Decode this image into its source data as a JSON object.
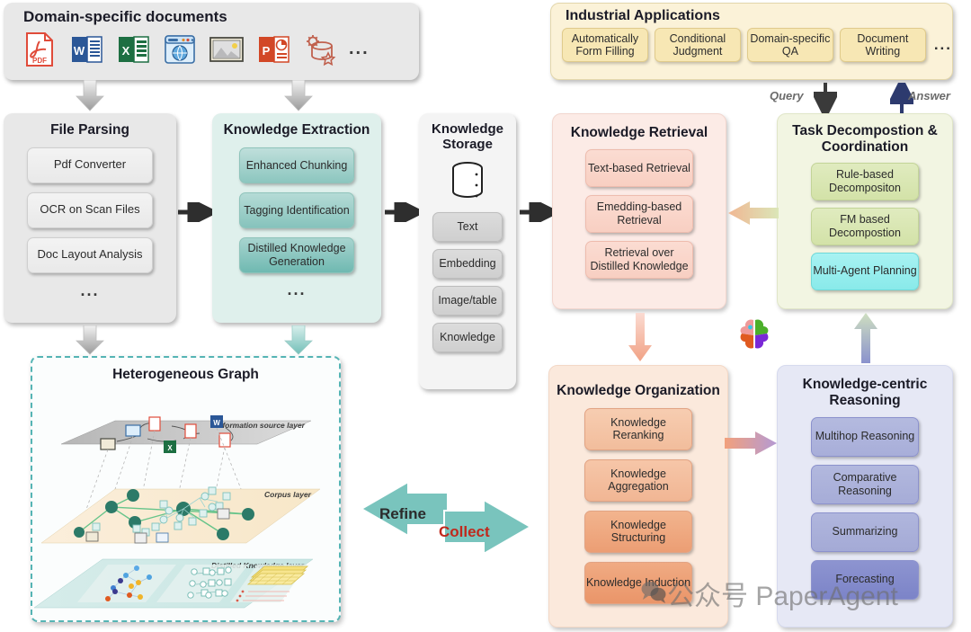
{
  "documents": {
    "title": "Domain-specific documents",
    "icons": [
      {
        "name": "pdf-icon",
        "label": "PDF"
      },
      {
        "name": "word-icon",
        "label": "W"
      },
      {
        "name": "excel-icon",
        "label": "X"
      },
      {
        "name": "webpage-icon",
        "label": ""
      },
      {
        "name": "image-icon",
        "label": ""
      },
      {
        "name": "powerpoint-icon",
        "label": "P"
      },
      {
        "name": "database-config-icon",
        "label": ""
      }
    ],
    "more": "..."
  },
  "applications": {
    "title": "Industrial Applications",
    "items": [
      "Automatically Form Filling",
      "Conditional Judgment",
      "Domain-specific QA",
      "Document Writing"
    ],
    "more": "..."
  },
  "file_parsing": {
    "title": "File Parsing",
    "items": [
      "Pdf Converter",
      "OCR on Scan Files",
      "Doc Layout Analysis"
    ],
    "more": "..."
  },
  "knowledge_extraction": {
    "title": "Knowledge Extraction",
    "items": [
      "Enhanced Chunking",
      "Tagging Identification",
      "Distilled Knowledge Generation"
    ],
    "more": "..."
  },
  "knowledge_storage": {
    "title": "Knowledge Storage",
    "icon": "database-icon",
    "items": [
      "Text",
      "Embedding",
      "Image/table",
      "Knowledge"
    ]
  },
  "knowledge_retrieval": {
    "title": "Knowledge Retrieval",
    "items": [
      "Text-based Retrieval",
      "Emedding-based Retrieval",
      "Retrieval over Distilled Knowledge"
    ]
  },
  "task_decomposition": {
    "title": "Task Decompostion & Coordination",
    "items": [
      "Rule-based Decompositon",
      "FM based Decompostion",
      "Multi-Agent Planning"
    ]
  },
  "knowledge_organization": {
    "title": "Knowledge Organization",
    "items": [
      "Knowledge Reranking",
      "Knowledge Aggregation",
      "Knowledge Structuring",
      "Knowledge Induction"
    ]
  },
  "knowledge_reasoning": {
    "title": "Knowledge-centric Reasoning",
    "items": [
      "Multihop Reasoning",
      "Comparative Reasoning",
      "Summarizing",
      "Forecasting"
    ]
  },
  "heterogeneous_graph": {
    "title": "Heterogeneous Graph",
    "layers": [
      "Information source layer",
      "Corpus layer",
      "Distilled Knowledge layer"
    ]
  },
  "flow_labels": {
    "refine": "Refine",
    "collect": "Collect",
    "query": "Query",
    "answer": "Answer"
  },
  "watermark": {
    "text": "公众号  PaperAgent"
  },
  "colors": {
    "teal": "#55b4b4",
    "collect_red": "#c0281c",
    "apps_bg": "#fbf2d8",
    "retrieval_bg": "#fcebe6",
    "task_bg": "#f2f5e2",
    "org_bg": "#fbe9dc",
    "reason_bg": "#e6e8f5"
  }
}
